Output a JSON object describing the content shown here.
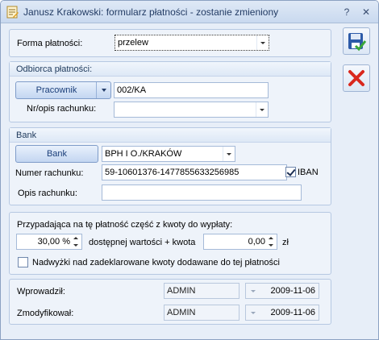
{
  "window": {
    "title": "Janusz Krakowski: formularz płatności - zostanie zmieniony",
    "help_label": "?",
    "close_label": "✕"
  },
  "payment": {
    "form_label": "Forma płatności:",
    "form_value": "przelew"
  },
  "recipient": {
    "legend": "Odbiorca płatności:",
    "type_button": "Pracownik",
    "code": "002/KA",
    "account_label": "Nr/opis rachunku:",
    "account_value": ""
  },
  "bank": {
    "legend": "Bank",
    "bank_button": "Bank",
    "bank_value": "BPH I O./KRAKÓW",
    "account_number_label": "Numer rachunku:",
    "account_number": "59-10601376-1477855633256985",
    "iban_label": "IBAN",
    "iban_checked": true,
    "account_desc_label": "Opis rachunku:",
    "account_desc": ""
  },
  "share": {
    "heading": "Przypadająca na tę płatność część z kwoty do wypłaty:",
    "percent": "30,00 %",
    "middle_text": "dostępnej wartości + kwota",
    "amount": "0,00",
    "currency": "zł",
    "surplus_label": "Nadwyżki nad zadeklarowane kwoty dodawane do tej płatności",
    "surplus_checked": false
  },
  "audit": {
    "entered_label": "Wprowadził:",
    "entered_by": "ADMIN",
    "entered_date": "2009-11-06",
    "modified_label": "Zmodyfikował:",
    "modified_by": "ADMIN",
    "modified_date": "2009-11-06"
  },
  "icons": {
    "save": "save-icon",
    "cancel": "cancel-icon",
    "app": "form-icon"
  },
  "colors": {
    "accent": "#1b3f7a",
    "cancel_red": "#d9281e",
    "save_green": "#3aa63a"
  }
}
